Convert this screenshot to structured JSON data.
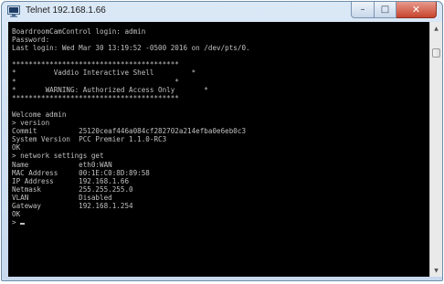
{
  "window": {
    "title": "Telnet 192.168.1.66",
    "icon": "telnet-app-icon",
    "controls": {
      "minimize_glyph": "–",
      "maximize_glyph": "□",
      "close_glyph": "✕"
    }
  },
  "terminal": {
    "lines": [
      "BoardroomCamControl login: admin",
      "Password:",
      "Last login: Wed Mar 30 13:19:52 -0500 2016 on /dev/pts/0.",
      "",
      "****************************************",
      "*         Vaddio Interactive Shell         *",
      "*                                      *",
      "*       WARNING: Authorized Access Only       *",
      "****************************************",
      "",
      "Welcome admin",
      "> version",
      "Commit          25120ceaf446a084cf282702a214efba0e6eb0c3",
      "System Version  PCC Premier 1.1.0-RC3",
      "OK",
      "> network settings get",
      "Name            eth0:WAN",
      "MAC Address     00:1E:C0:8D:89:58",
      "IP Address      192.168.1.66",
      "Netmask         255.255.255.0",
      "VLAN            Disabled",
      "Gateway         192.168.1.254",
      "OK",
      "> "
    ]
  },
  "colors": {
    "terminal_background": "#000000",
    "terminal_text": "#c0c0c0",
    "close_button": "#c7442e"
  }
}
